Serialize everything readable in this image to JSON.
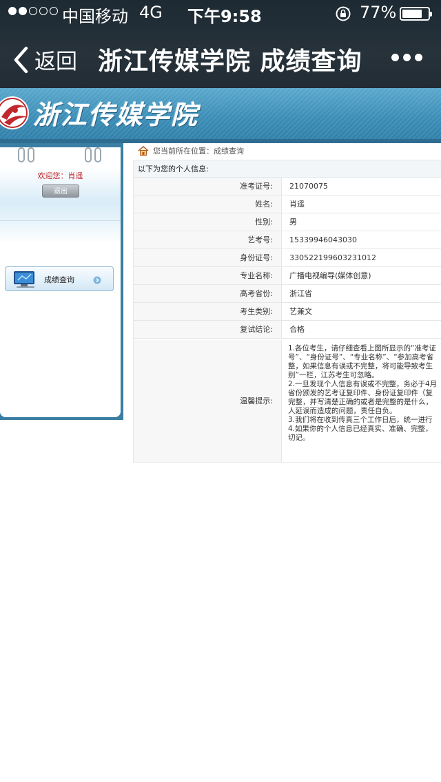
{
  "status_bar": {
    "carrier": "中国移动",
    "network": "4G",
    "time": "下午9:58",
    "battery_percent": "77%",
    "battery_level": 0.77,
    "signal_bars_filled": 2,
    "signal_bars_total": 5
  },
  "nav": {
    "back_label": "返回",
    "title": "浙江传媒学院 成绩查询"
  },
  "site": {
    "name": "浙江传媒学院"
  },
  "sidebar": {
    "welcome_label": "欢迎您：",
    "user_name": "肖遥",
    "logout_label": "退出",
    "menu_item_label": "成绩查询"
  },
  "breadcrumb": {
    "prefix": "您当前所在位置：",
    "current": "成绩查询"
  },
  "info": {
    "header": "以下为您的个人信息:",
    "rows": [
      {
        "label": "准考证号:",
        "value": "21070075"
      },
      {
        "label": "姓名:",
        "value": "肖遥"
      },
      {
        "label": "性别:",
        "value": "男"
      },
      {
        "label": "艺考号:",
        "value": "15339946043030"
      },
      {
        "label": "身份证号:",
        "value": "330522199603231012"
      },
      {
        "label": "专业名称:",
        "value": "广播电视编导(媒体创意)"
      },
      {
        "label": "高考省份:",
        "value": "浙江省"
      },
      {
        "label": "考生类别:",
        "value": "艺兼文"
      },
      {
        "label": "复试结论:",
        "value": "合格"
      }
    ],
    "tips_label": "温馨提示:",
    "tips_lines": [
      "1.各位考生，请仔细查看上图所显示的“准考证",
      "号”、“身份证号”、“专业名称”、“参加高考省",
      "整，如果信息有误或不完整，将可能导致考生",
      "别”一栏，江苏考生可忽略。",
      "2.一旦发现个人信息有误或不完整，务必于4月",
      "省份颁发的艺考证复印件、身份证复印件（复",
      "完整，并写清楚正确的或者是完整的是什么，",
      "人延误而造成的问题，责任自负。",
      "3.我们将在收到传真三个工作日后，统一进行",
      "4.如果你的个人信息已经真实、准确、完整，",
      "切记。"
    ]
  }
}
